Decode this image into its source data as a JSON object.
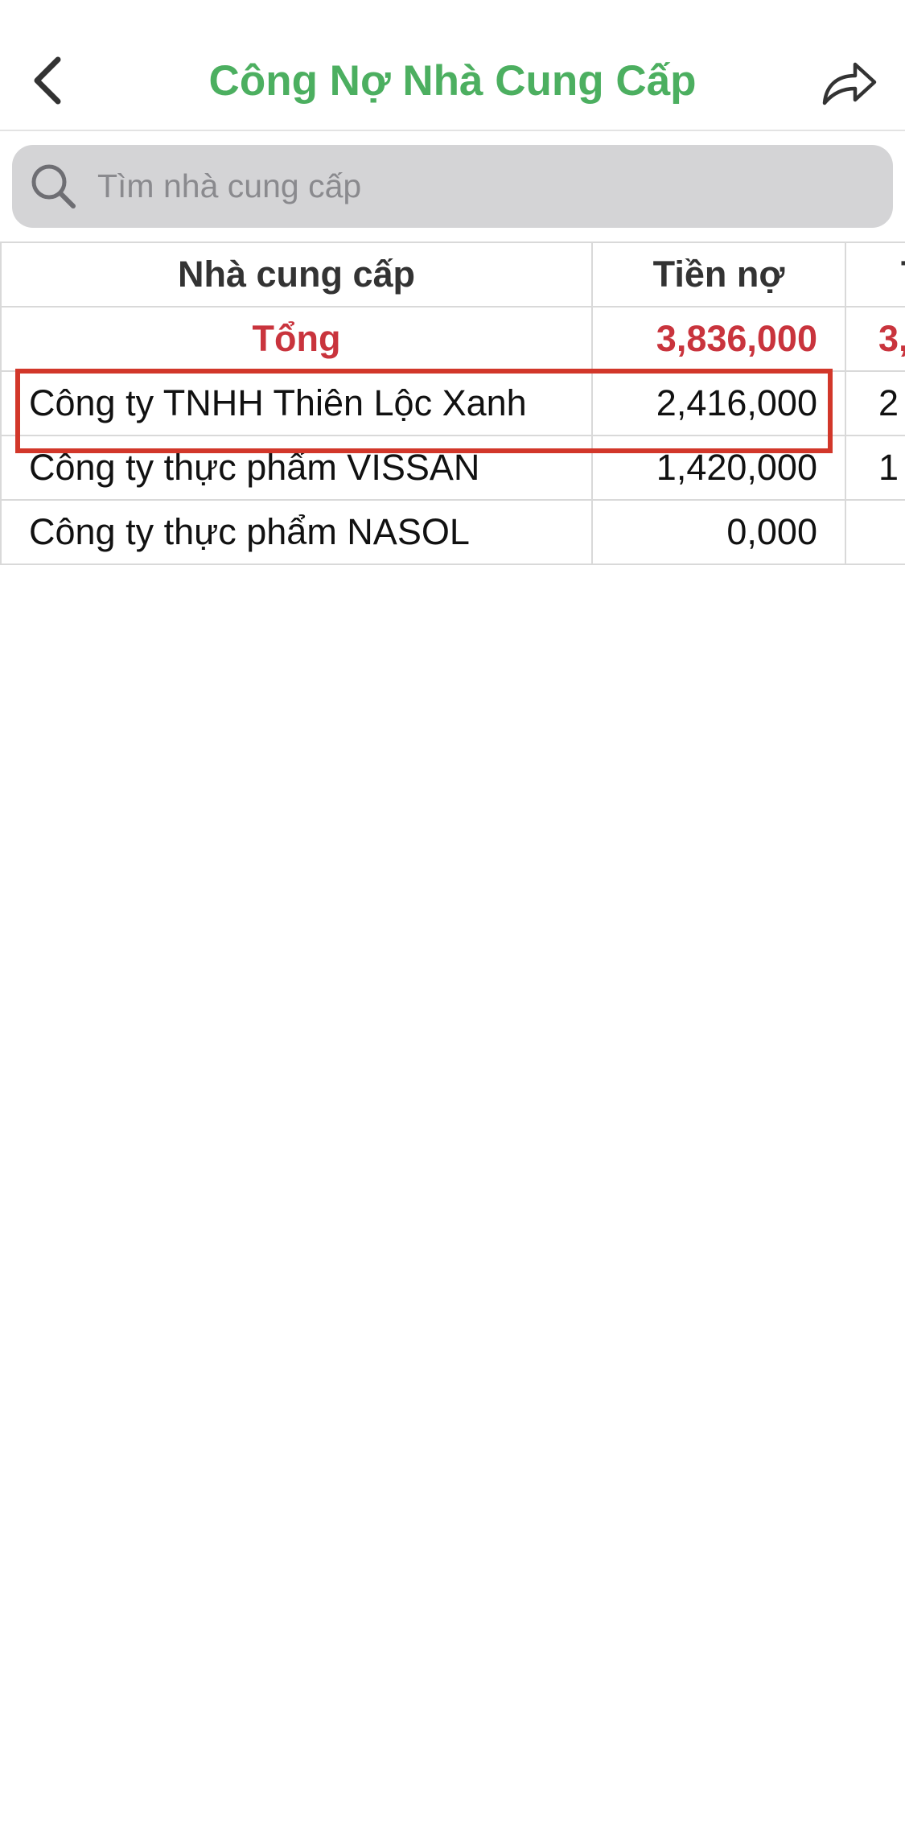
{
  "header": {
    "title": "Công Nợ Nhà Cung Cấp",
    "back_icon": "chevron-left-icon",
    "share_icon": "share-arrow-icon",
    "title_color": "#4caf60"
  },
  "search": {
    "placeholder": "Tìm nhà cung cấp",
    "value": ""
  },
  "table": {
    "headers": {
      "supplier": "Nhà cung cấp",
      "debt": "Tiền nợ",
      "extra": "T"
    },
    "total": {
      "label": "Tổng",
      "debt": "3,836,000",
      "extra": "3,"
    },
    "rows": [
      {
        "name": "Công ty TNHH Thiên Lộc Xanh",
        "debt": "2,416,000",
        "extra": "2"
      },
      {
        "name": "Công ty thực phẩm VISSAN",
        "debt": "1,420,000",
        "extra": "1"
      },
      {
        "name": "Công ty thực phẩm NASOL",
        "debt": "0,000",
        "extra": ""
      }
    ]
  },
  "colors": {
    "total_text": "#c9343d",
    "highlight_border": "#d2372a",
    "search_bg": "#d4d4d6"
  }
}
